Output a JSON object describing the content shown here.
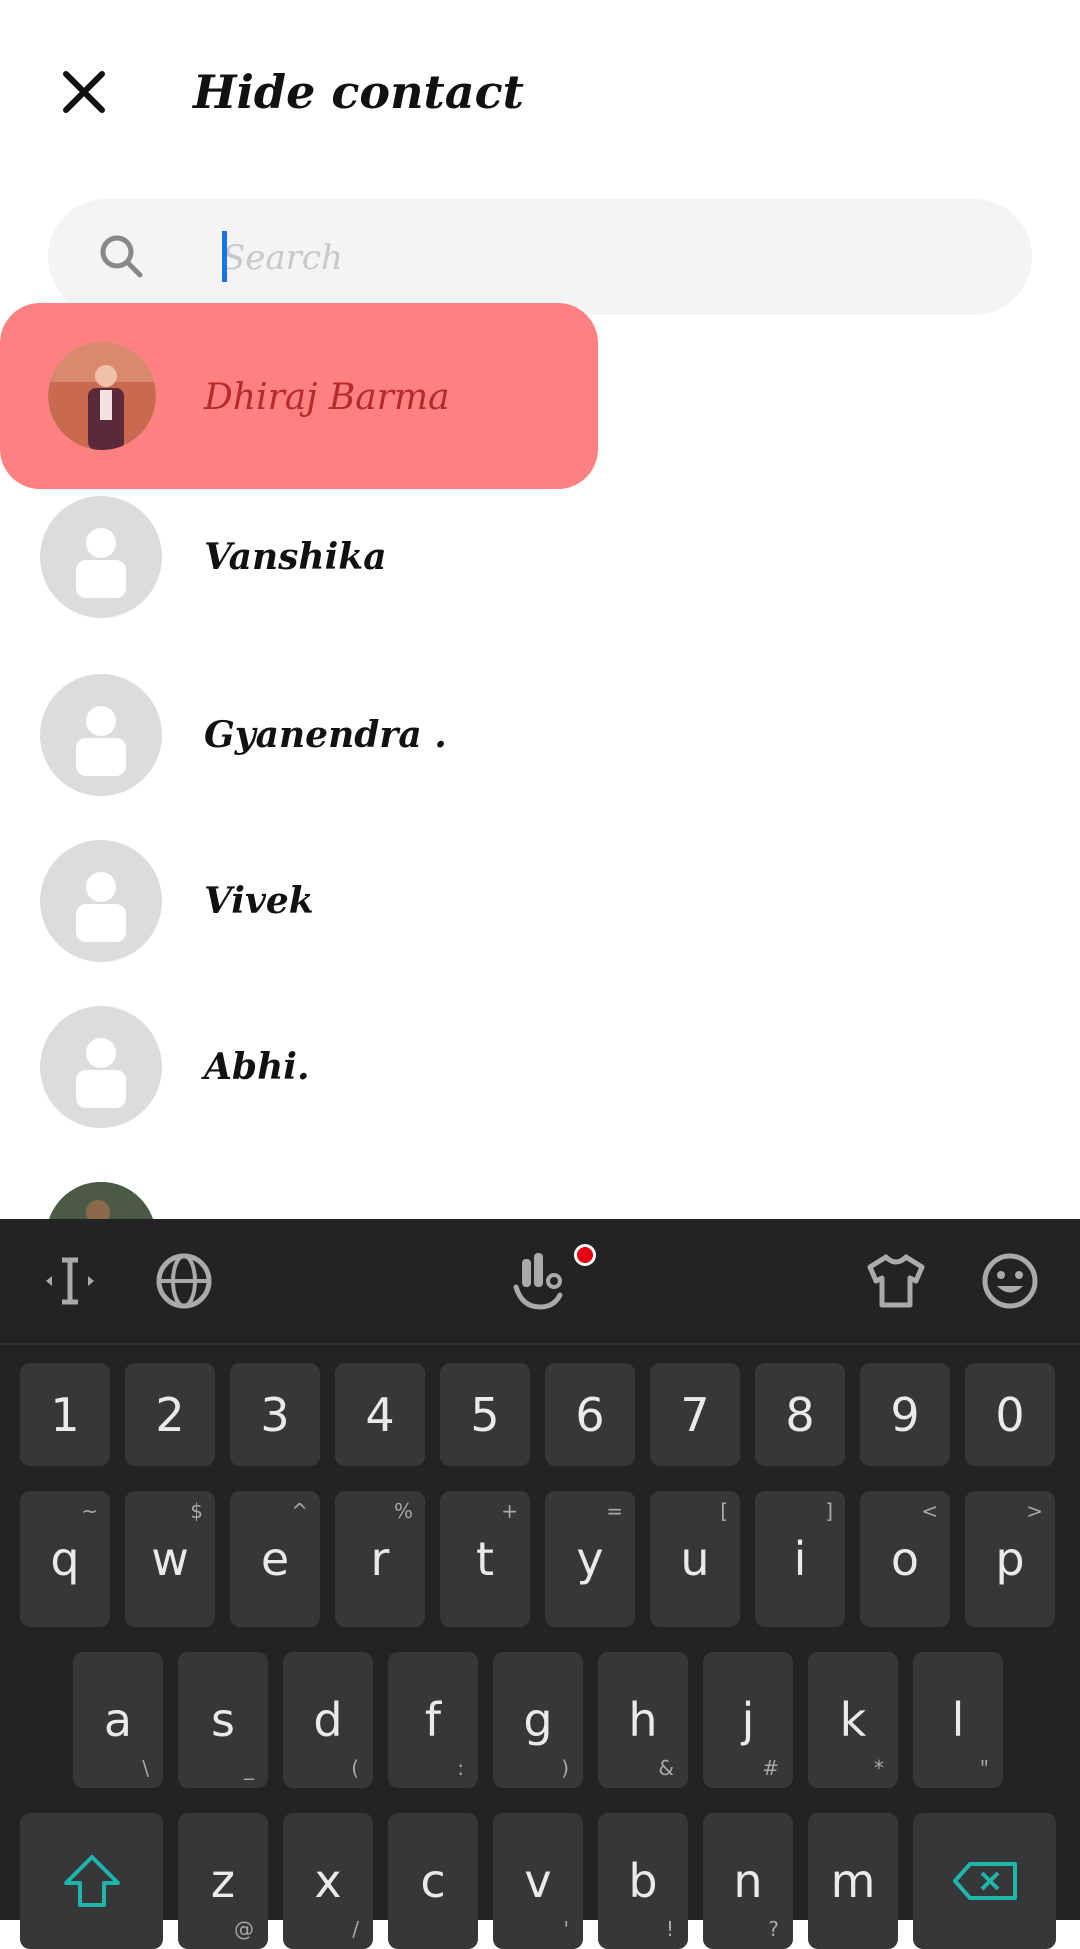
{
  "header": {
    "title": "Hide contact"
  },
  "search": {
    "placeholder": "Search"
  },
  "contacts": [
    {
      "name": "Dhiraj Barma",
      "has_photo": true
    },
    {
      "name": "Vanshika",
      "has_photo": false
    },
    {
      "name": "Gyanendra .",
      "has_photo": false
    },
    {
      "name": "Vivek",
      "has_photo": false
    },
    {
      "name": "Abhi.",
      "has_photo": false
    }
  ],
  "keyboard": {
    "toolbar_icons": [
      "text-cursor-icon",
      "globe-icon",
      "gesture-hand-icon",
      "shirt-theme-icon",
      "emoji-icon"
    ],
    "numbers": [
      "1",
      "2",
      "3",
      "4",
      "5",
      "6",
      "7",
      "8",
      "9",
      "0"
    ],
    "row1": [
      {
        "k": "q",
        "s": "~"
      },
      {
        "k": "w",
        "s": "$"
      },
      {
        "k": "e",
        "s": "^"
      },
      {
        "k": "r",
        "s": "%"
      },
      {
        "k": "t",
        "s": "+"
      },
      {
        "k": "y",
        "s": "="
      },
      {
        "k": "u",
        "s": "["
      },
      {
        "k": "i",
        "s": "]"
      },
      {
        "k": "o",
        "s": "<"
      },
      {
        "k": "p",
        "s": ">"
      }
    ],
    "row2": [
      {
        "k": "a",
        "s": "\\"
      },
      {
        "k": "s",
        "s": "_"
      },
      {
        "k": "d",
        "s": "("
      },
      {
        "k": "f",
        "s": ":"
      },
      {
        "k": "g",
        "s": ")"
      },
      {
        "k": "h",
        "s": "&"
      },
      {
        "k": "j",
        "s": "#"
      },
      {
        "k": "k",
        "s": "*"
      },
      {
        "k": "l",
        "s": "\""
      }
    ],
    "row3": [
      {
        "k": "z",
        "s": "@"
      },
      {
        "k": "x",
        "s": "/"
      },
      {
        "k": "c",
        "s": ""
      },
      {
        "k": "v",
        "s": "'"
      },
      {
        "k": "b",
        "s": "!"
      },
      {
        "k": "n",
        "s": "?"
      },
      {
        "k": "m",
        "s": ""
      }
    ]
  },
  "colors": {
    "highlight": "#ff8080",
    "accent_teal": "#1fb5ac",
    "keyboard_bg": "#222324",
    "notification_dot": "#e60012"
  }
}
